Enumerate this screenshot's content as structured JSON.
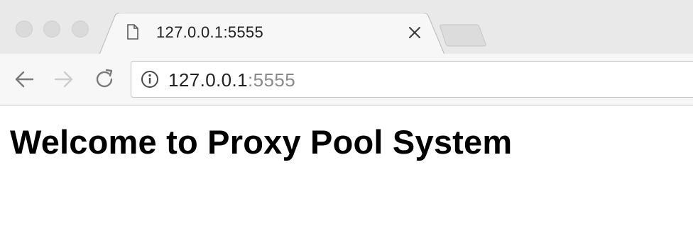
{
  "window": {
    "traffic_lights": [
      "close",
      "minimize",
      "zoom"
    ]
  },
  "tab": {
    "title": "127.0.0.1:5555",
    "favicon": "document-icon",
    "close_icon": "close-icon"
  },
  "toolbar": {
    "back_icon": "arrow-left-icon",
    "forward_icon": "arrow-right-icon",
    "reload_icon": "reload-icon"
  },
  "omnibox": {
    "security_icon": "info-icon",
    "url_host": "127.0.0.1",
    "url_port": ":5555"
  },
  "page": {
    "heading": "Welcome to Proxy Pool System"
  }
}
